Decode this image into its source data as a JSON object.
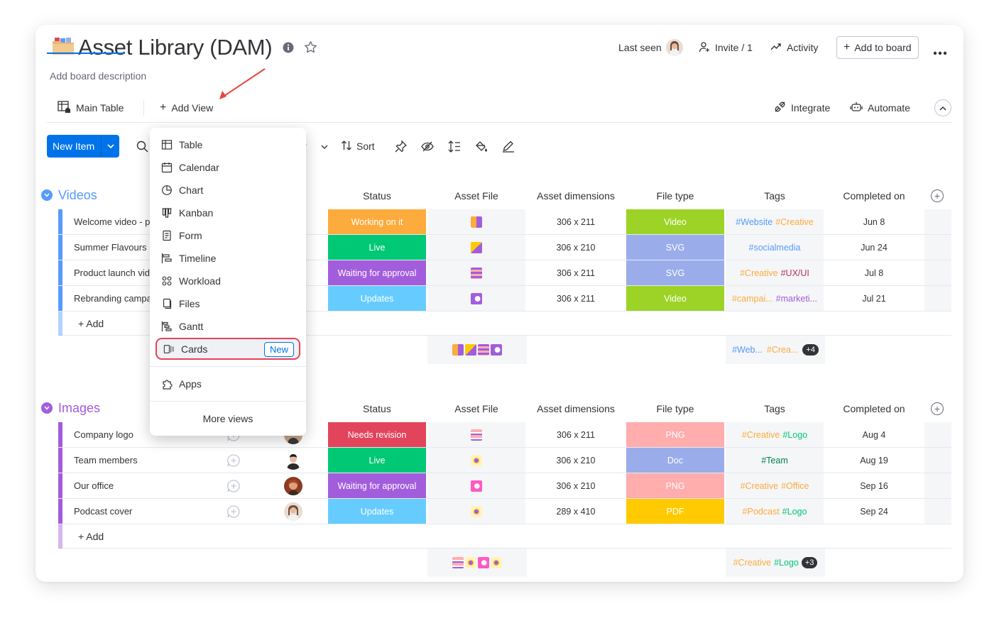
{
  "header": {
    "title": "Asset Library (DAM)",
    "description": "Add board description",
    "last_seen_label": "Last seen",
    "invite_label": "Invite / 1",
    "activity_label": "Activity",
    "add_to_board_label": "Add to board"
  },
  "tabs": {
    "main_table": "Main Table",
    "add_view": "Add View",
    "integrate": "Integrate",
    "automate": "Automate"
  },
  "toolbar": {
    "new_item": "New Item",
    "filter_fragment": "r",
    "sort": "Sort"
  },
  "views_menu": {
    "items": [
      "Table",
      "Calendar",
      "Chart",
      "Kanban",
      "Form",
      "Timeline",
      "Workload",
      "Files",
      "Gantt",
      "Cards"
    ],
    "new_badge": "New",
    "apps": "Apps",
    "more_views": "More views"
  },
  "columns": {
    "person_fragment": "er",
    "status": "Status",
    "asset_file": "Asset File",
    "asset_dimensions": "Asset dimensions",
    "file_type": "File type",
    "tags": "Tags",
    "completed_on": "Completed on"
  },
  "add_row_label": "+ Add",
  "groups": [
    {
      "name": "Videos",
      "color": "#579bfc",
      "rows": [
        {
          "name": "Welcome video - p",
          "status": "Working on it",
          "status_color": "#fdab3d",
          "dimensions": "306 x 211",
          "file_type": "Video",
          "file_type_color": "#9cd326",
          "tags": [
            {
              "text": "#Website",
              "color": "#579bfc"
            },
            {
              "text": "#Creative",
              "color": "#fdab3d"
            }
          ],
          "completed": "Jun 8"
        },
        {
          "name": "Summer Flavours (",
          "status": "Live",
          "status_color": "#00c875",
          "dimensions": "306 x 210",
          "file_type": "SVG",
          "file_type_color": "#9aadea",
          "tags": [
            {
              "text": "#socialmedia",
              "color": "#579bfc"
            }
          ],
          "completed": "Jun 24"
        },
        {
          "name": "Product launch vid",
          "status": "Waiting for approval",
          "status_color": "#a25ddc",
          "dimensions": "306 x 211",
          "file_type": "SVG",
          "file_type_color": "#9aadea",
          "tags": [
            {
              "text": "#Creative",
              "color": "#fdab3d"
            },
            {
              "text": "#UX/UI",
              "color": "#bb3354"
            }
          ],
          "completed": "Jul 8"
        },
        {
          "name": "Rebranding campa",
          "status": "Updates",
          "status_color": "#66ccff",
          "dimensions": "306 x 211",
          "file_type": "Video",
          "file_type_color": "#9cd326",
          "tags": [
            {
              "text": "#campai...",
              "color": "#fdab3d"
            },
            {
              "text": "#marketi...",
              "color": "#a25ddc"
            }
          ],
          "completed": "Jul 21"
        }
      ],
      "summary_tags": [
        {
          "text": "#Web...",
          "color": "#579bfc"
        },
        {
          "text": "#Crea...",
          "color": "#fdab3d"
        }
      ],
      "summary_more": "+4"
    },
    {
      "name": "Images",
      "color": "#a25ddc",
      "rows": [
        {
          "name": "Company logo",
          "status": "Needs revision",
          "status_color": "#e2445c",
          "dimensions": "306 x 211",
          "file_type": "PNG",
          "file_type_color": "#ffadad",
          "tags": [
            {
              "text": "#Creative",
              "color": "#fdab3d"
            },
            {
              "text": "#Logo",
              "color": "#00c875"
            }
          ],
          "completed": "Aug 4"
        },
        {
          "name": "Team members",
          "status": "Live",
          "status_color": "#00c875",
          "dimensions": "306 x 210",
          "file_type": "Doc",
          "file_type_color": "#9aadea",
          "tags": [
            {
              "text": "#Team",
              "color": "#037f4c"
            }
          ],
          "completed": "Aug 19"
        },
        {
          "name": "Our office",
          "status": "Waiting for approval",
          "status_color": "#a25ddc",
          "dimensions": "306 x 210",
          "file_type": "PNG",
          "file_type_color": "#ffadad",
          "tags": [
            {
              "text": "#Creative",
              "color": "#fdab3d"
            },
            {
              "text": "#Office",
              "color": "#fdab3d"
            }
          ],
          "completed": "Sep 16"
        },
        {
          "name": "Podcast cover",
          "status": "Updates",
          "status_color": "#66ccff",
          "dimensions": "289 x 410",
          "file_type": "PDF",
          "file_type_color": "#ffcb00",
          "tags": [
            {
              "text": "#Podcast",
              "color": "#fdab3d"
            },
            {
              "text": "#Logo",
              "color": "#00c875"
            }
          ],
          "completed": "Sep 24"
        }
      ],
      "summary_tags": [
        {
          "text": "#Creative",
          "color": "#fdab3d"
        },
        {
          "text": "#Logo",
          "color": "#00c875"
        }
      ],
      "summary_more": "+3"
    }
  ],
  "colors": {
    "primary": "#0073ea",
    "highlight": "#e2445c",
    "annotation_arrow": "#e8453c"
  }
}
